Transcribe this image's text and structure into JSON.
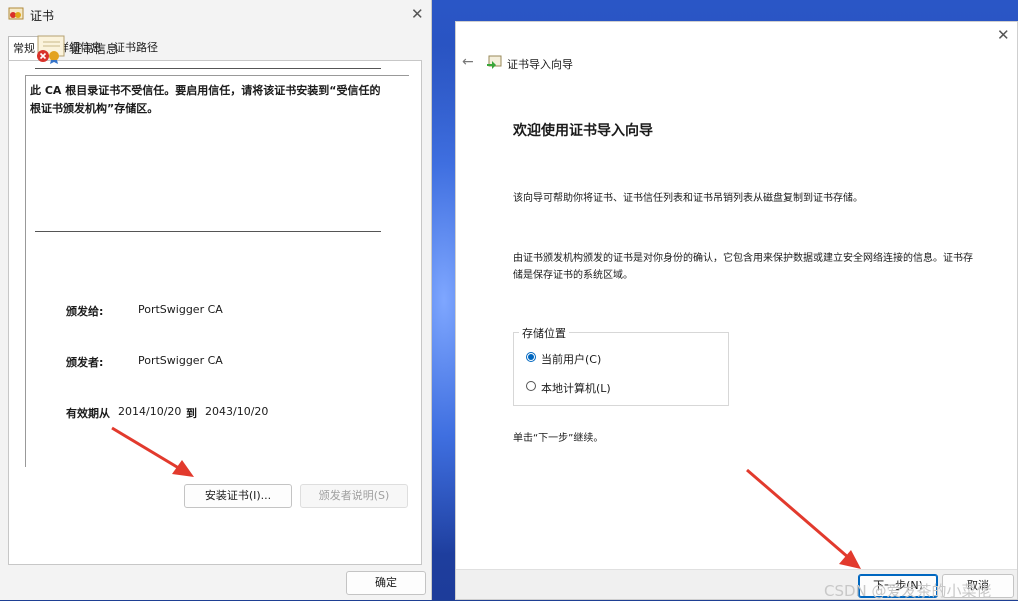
{
  "cert_window": {
    "title": "证书",
    "tabs": [
      "常规",
      "详细信息",
      "证书路径"
    ],
    "info_title": "证书信息",
    "warning": "此 CA 根目录证书不受信任。要启用信任，请将该证书安装到“受信任的根证书颁发机构”存储区。",
    "issued_to_label": "颁发给:",
    "issued_to_value": "PortSwigger CA",
    "issued_by_label": "颁发者:",
    "issued_by_value": "PortSwigger CA",
    "valid_from_label": "有效期从",
    "valid_from_value": "2014/10/20",
    "valid_to_label": "到",
    "valid_to_value": "2043/10/20",
    "install_button": "安装证书(I)...",
    "issuer_statement_button": "颁发者说明(S)",
    "ok_button": "确定"
  },
  "wizard_window": {
    "title": "证书导入向导",
    "heading": "欢迎使用证书导入向导",
    "intro": "该向导可帮助你将证书、证书信任列表和证书吊销列表从磁盘复制到证书存储。",
    "description": "由证书颁发机构颁发的证书是对你身份的确认，它包含用来保护数据或建立安全网络连接的信息。证书存储是保存证书的系统区域。",
    "store_location_label": "存储位置",
    "options": [
      "当前用户(C)",
      "本地计算机(L)"
    ],
    "selected_option": "当前用户(C)",
    "continue_hint": "单击“下一步”继续。",
    "next_button": "下一步(N)",
    "cancel_button": "取消"
  },
  "watermark": "CSDN @爱发茶的小菜佬",
  "colors": {
    "accent": "#0067c0",
    "arrow_red": "#e23a2d",
    "wallpaper": "#1e3f93"
  },
  "icons": [
    "certificate-icon",
    "certificate-error-icon",
    "close-icon",
    "back-arrow-icon",
    "certificate-import-icon",
    "red-arrow-annotation"
  ]
}
